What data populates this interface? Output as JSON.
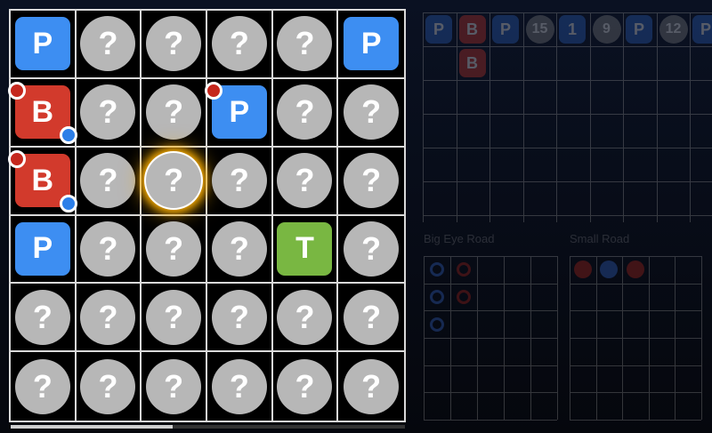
{
  "grid": {
    "rows": [
      [
        {
          "type": "P"
        },
        {
          "type": "?"
        },
        {
          "type": "?"
        },
        {
          "type": "?"
        },
        {
          "type": "?"
        },
        {
          "type": "P"
        }
      ],
      [
        {
          "type": "B",
          "dots": [
            "red",
            "blue"
          ]
        },
        {
          "type": "?"
        },
        {
          "type": "?"
        },
        {
          "type": "P",
          "dots": [
            "red"
          ]
        },
        {
          "type": "?"
        },
        {
          "type": "?"
        }
      ],
      [
        {
          "type": "B",
          "dots": [
            "red",
            "blue"
          ]
        },
        {
          "type": "?"
        },
        {
          "type": "?",
          "selected": true
        },
        {
          "type": "?"
        },
        {
          "type": "?"
        },
        {
          "type": "?"
        }
      ],
      [
        {
          "type": "P"
        },
        {
          "type": "?"
        },
        {
          "type": "?"
        },
        {
          "type": "?"
        },
        {
          "type": "T"
        },
        {
          "type": "?"
        }
      ],
      [
        {
          "type": "?"
        },
        {
          "type": "?"
        },
        {
          "type": "?"
        },
        {
          "type": "?"
        },
        {
          "type": "?"
        },
        {
          "type": "?"
        }
      ],
      [
        {
          "type": "?"
        },
        {
          "type": "?"
        },
        {
          "type": "?"
        },
        {
          "type": "?"
        },
        {
          "type": "?"
        },
        {
          "type": "?"
        }
      ]
    ]
  },
  "bead_road": {
    "top_row": [
      {
        "kind": "P",
        "text": "P"
      },
      {
        "kind": "B",
        "text": "B"
      },
      {
        "kind": "P",
        "text": "P"
      },
      {
        "kind": "N",
        "text": "15"
      },
      {
        "kind": "P",
        "text": "1"
      },
      {
        "kind": "N",
        "text": "9"
      },
      {
        "kind": "P",
        "text": "P"
      },
      {
        "kind": "N",
        "text": "12"
      },
      {
        "kind": "P",
        "text": "P"
      }
    ],
    "second_row": [
      {
        "kind": "B",
        "text": "B"
      }
    ]
  },
  "big_eye_road": {
    "label": "Big Eye Road",
    "marks": [
      {
        "col": 0,
        "row": 0,
        "color": "blue"
      },
      {
        "col": 1,
        "row": 0,
        "color": "red"
      },
      {
        "col": 0,
        "row": 1,
        "color": "blue"
      },
      {
        "col": 1,
        "row": 1,
        "color": "red"
      },
      {
        "col": 0,
        "row": 2,
        "color": "blue"
      }
    ]
  },
  "small_road": {
    "label": "Small Road",
    "marks": [
      {
        "col": 0,
        "row": 0,
        "color": "red"
      },
      {
        "col": 1,
        "row": 0,
        "color": "blue"
      },
      {
        "col": 2,
        "row": 0,
        "color": "red"
      }
    ]
  },
  "colors": {
    "player": "#3d8ef2",
    "banker": "#d23a2c",
    "tie": "#79b742",
    "hidden": "#b7b7b7"
  },
  "scroll": {
    "position_fraction": 0.0,
    "visible_fraction": 0.41
  }
}
